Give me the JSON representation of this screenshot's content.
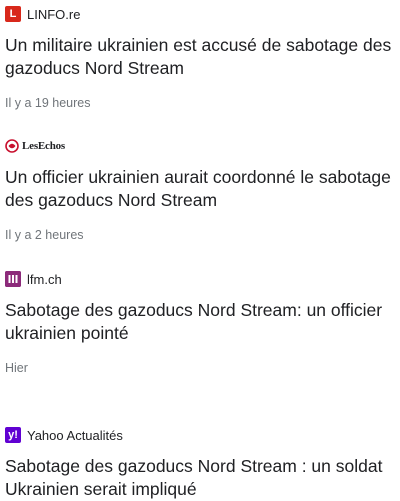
{
  "articles": [
    {
      "source": "LINFO.re",
      "logo_glyph": "L",
      "logo_color": "#d8281b",
      "headline": "Un militaire ukrainien est accusé de sabotage des gazoducs Nord Stream",
      "time": "Il y a 19 heures"
    },
    {
      "source": "LesEchos",
      "logo_color": "#c8102e",
      "headline": "Un officier ukrainien aurait coordonné le sabotage des gazoducs Nord Stream",
      "time": "Il y a 2 heures"
    },
    {
      "source": "lfm.ch",
      "logo_color": "#8c2a7a",
      "headline": "Sabotage des gazoducs Nord Stream: un officier ukrainien pointé",
      "time": "Hier"
    },
    {
      "source": "Yahoo Actualités",
      "logo_glyph": "y!",
      "logo_color": "#6001d2",
      "headline": "Sabotage des gazoducs Nord Stream : un soldat Ukrainien serait impliqué"
    }
  ]
}
